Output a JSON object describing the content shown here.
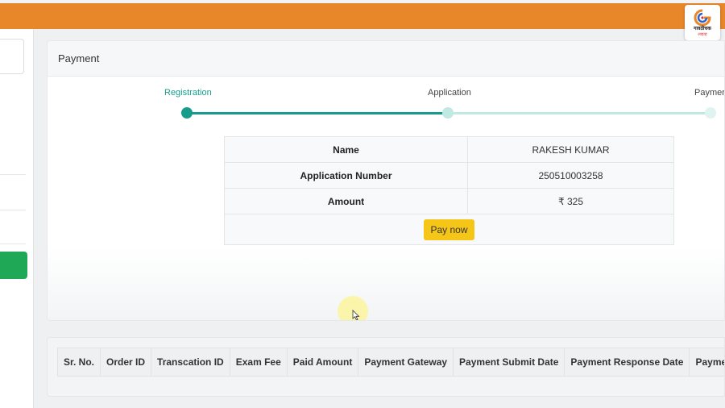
{
  "logo": {
    "text": "गावठीचक",
    "sub": "लाइव्ह"
  },
  "payment_card": {
    "title": "Payment"
  },
  "steps": [
    {
      "label": "Registration",
      "state": "done"
    },
    {
      "label": "Application",
      "state": "current"
    },
    {
      "label": "Payment",
      "state": "pending"
    }
  ],
  "details": {
    "name_label": "Name",
    "name_value": "RAKESH KUMAR",
    "appno_label": "Application Number",
    "appno_value": "250510003258",
    "amount_label": "Amount",
    "amount_value": "₹ 325",
    "pay_button": "Pay now"
  },
  "history": {
    "columns": [
      "Sr. No.",
      "Order ID",
      "Transcation ID",
      "Exam Fee",
      "Paid Amount",
      "Payment Gateway",
      "Payment Submit Date",
      "Payment Response Date",
      "Payment Status"
    ]
  },
  "colors": {
    "topbar": "#e8862a",
    "step_done": "#169c8a",
    "step_pending": "#bfe9e2",
    "pay_button": "#f5c518",
    "sidebar_active": "#1fa855"
  },
  "icons": {
    "logo": "channel-logo-icon",
    "cursor": "mouse-cursor-icon"
  }
}
